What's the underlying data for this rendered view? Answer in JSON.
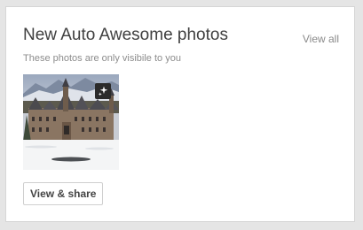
{
  "card": {
    "title": "New Auto Awesome photos",
    "view_all_label": "View all",
    "subtitle": "These photos are only visibile to you"
  },
  "photo": {
    "badge_icon": "auto-awesome-sparkle-icon"
  },
  "actions": {
    "view_share_label": "View & share"
  },
  "colors": {
    "background": "#e5e5e5",
    "card": "#ffffff",
    "title_text": "#404040",
    "muted_text": "#8c8c8c",
    "badge": "#2b2b2b"
  }
}
